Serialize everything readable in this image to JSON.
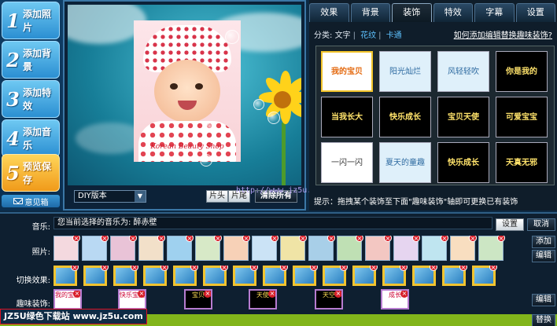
{
  "steps": [
    {
      "num": "1",
      "label": "添加照片"
    },
    {
      "num": "2",
      "label": "添加背景"
    },
    {
      "num": "3",
      "label": "添加特效"
    },
    {
      "num": "4",
      "label": "添加音乐"
    },
    {
      "num": "5",
      "label": "预览保存"
    }
  ],
  "mailbox_label": "意见箱",
  "preview": {
    "watermark": "Korean Beauty Shop",
    "select_value": "DIY版本",
    "btn_head": "片头",
    "btn_tail": "片尾",
    "btn_clear": "清除所有",
    "bar_watermark": "http://www.jz5u.com"
  },
  "tabs": [
    "效果",
    "背景",
    "装饰",
    "特效",
    "字幕",
    "设置"
  ],
  "filter": {
    "label": "分类:",
    "options": [
      "文字",
      "花纹",
      "卡通"
    ],
    "selected": "花纹",
    "help_link": "如何添加编辑替换趣味装饰?"
  },
  "deco_items": [
    "我的宝贝",
    "阳光灿烂",
    "风轻轻吹",
    "你是我的",
    "当我长大",
    "快乐成长",
    "宝贝天使",
    "可爱宝宝",
    "一闪一闪",
    "夏天的童趣",
    "快乐成长",
    "天真无邪"
  ],
  "tip": "提示：拖拽某个装饰至下面\"趣味装饰\"轴即可更换已有装饰",
  "timeline": {
    "music_label": "音乐:",
    "music_text": "您当前选择的音乐为: 醉赤壁",
    "settings_btn": "设置",
    "cancel_btn": "取消",
    "photo_label": "照片:",
    "add_btn": "添加",
    "edit_btn": "编辑",
    "trans_label": "切换效果:",
    "fx_label": "趣味装饰:",
    "edit_btn2": "编辑",
    "replace_btn": "替换",
    "fx_items": [
      "我的宝贝",
      "快乐宝宝",
      "宝贝",
      "天使",
      "天空",
      "成长"
    ]
  },
  "site_badge": "JZ5U绿色下载站 www.jz5u.com"
}
